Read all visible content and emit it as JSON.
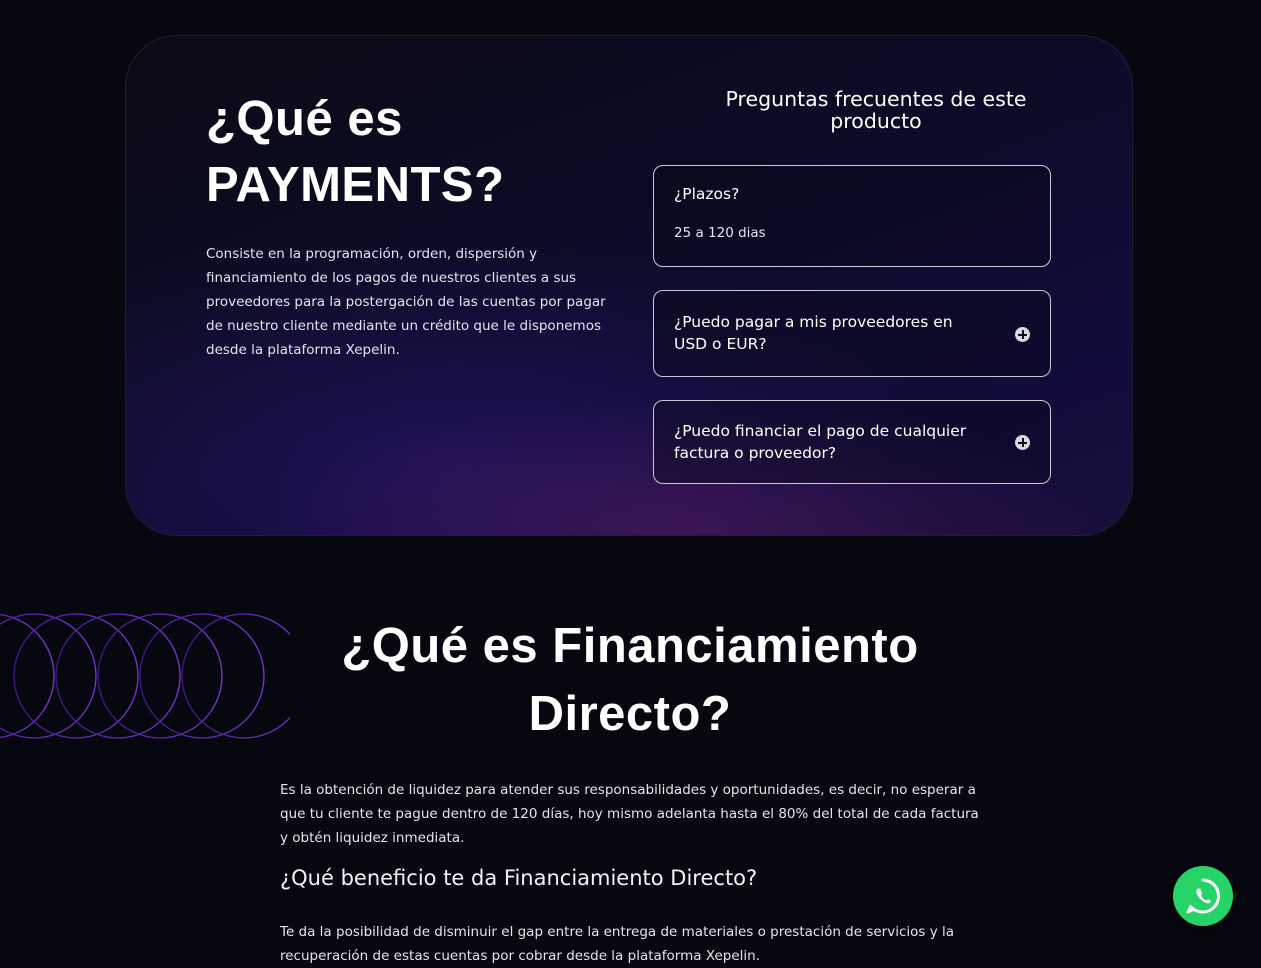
{
  "payments": {
    "title_line1": "¿Qué es",
    "title_line2": "PAYMENTS?",
    "description": "Consiste en la programación, orden, dispersión y financiamiento de los pagos de nuestros clientes a sus proveedores para la postergación de las cuentas por pagar de nuestro cliente mediante un crédito que le disponemos desde la plataforma Xepelin."
  },
  "faq": {
    "title": "Preguntas frecuentes de este producto",
    "items": [
      {
        "question": "¿Plazos?",
        "answer": "25 a 120 dias",
        "expanded": true
      },
      {
        "question": "¿Puedo pagar a mis proveedores en USD o EUR?",
        "expanded": false
      },
      {
        "question": "¿Puedo financiar el pago de cualquier factura o proveedor?",
        "expanded": false
      }
    ]
  },
  "financiamiento": {
    "title_line1": "¿Qué es Financiamiento",
    "title_line2": "Directo?",
    "paragraph1": "Es la obtención de liquidez para atender sus responsabilidades y oportunidades, es decir, no esperar a que tu cliente te pague dentro de 120 días, hoy mismo adelanta hasta el 80% del total de cada factura y obtén liquidez inmediata.",
    "subtitle": "¿Qué beneficio te da Financiamiento Directo?",
    "paragraph2": "Te da la posibilidad de disminuir el gap entre la entrega de materiales o prestación de servicios y la recuperación de estas cuentas por cobrar desde la plataforma Xepelin."
  },
  "whatsapp": {
    "icon": "whatsapp-icon",
    "color": "#25d366"
  },
  "colors": {
    "background": "#07070f",
    "accent": "#6b2bd9",
    "card_gradient_end": "#1a0f3c"
  }
}
